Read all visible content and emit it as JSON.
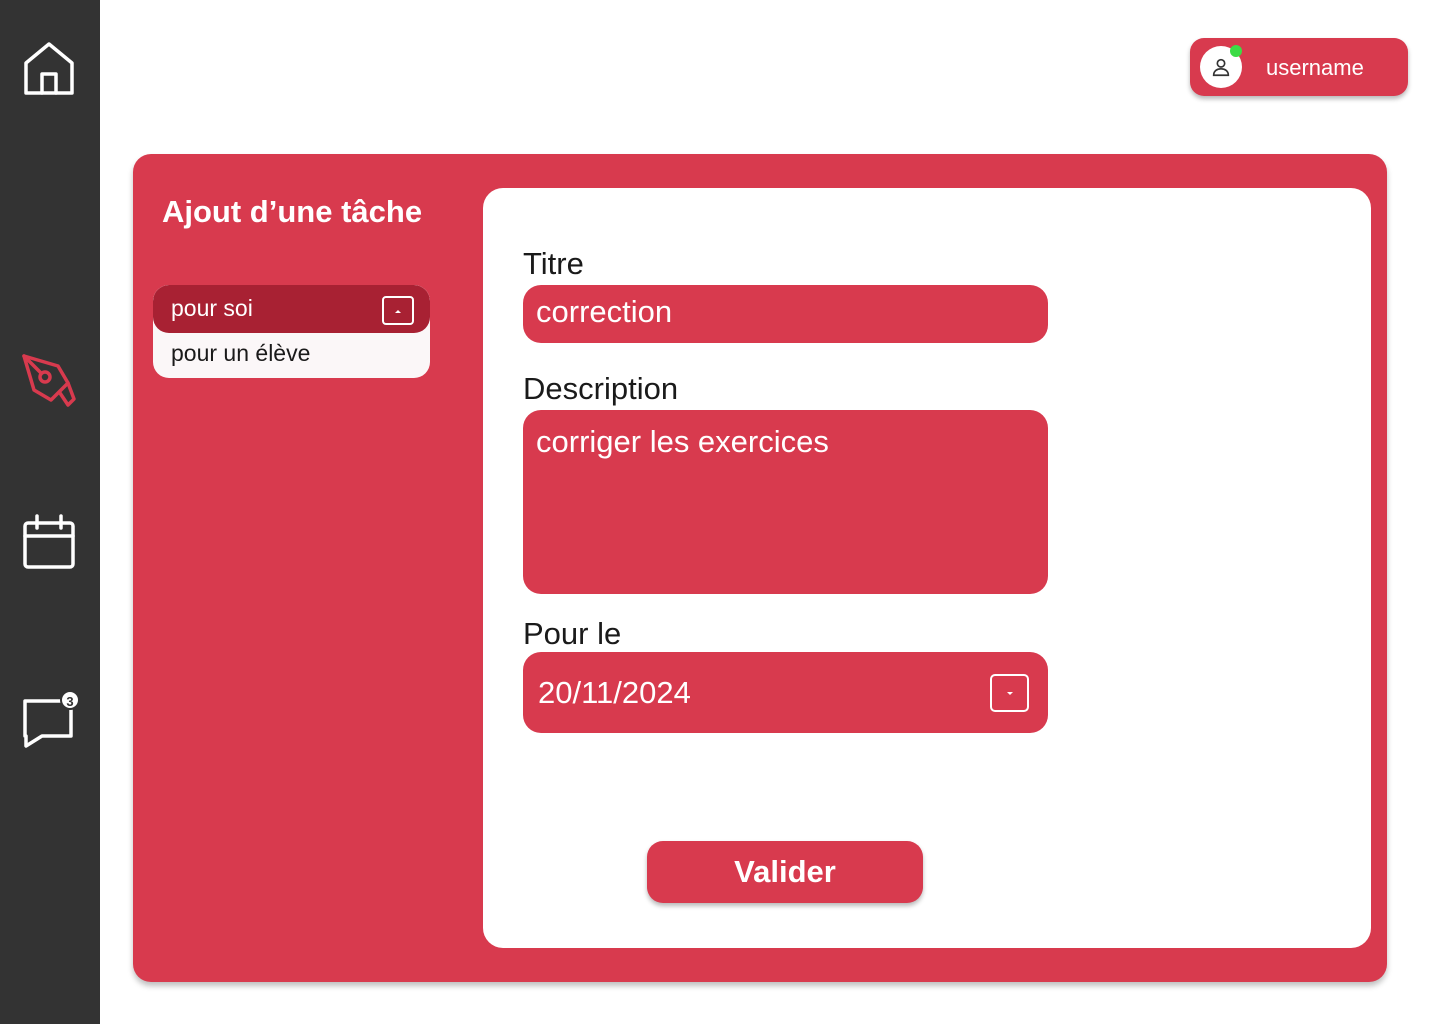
{
  "sidebar": {
    "items": [
      {
        "icon": "home-icon",
        "active": false
      },
      {
        "icon": "pen-nib-icon",
        "active": true
      },
      {
        "icon": "calendar-icon",
        "active": false
      },
      {
        "icon": "chat-bubble-icon",
        "active": false,
        "badge": "3"
      }
    ]
  },
  "user": {
    "name": "username",
    "status": "online",
    "icon": "user-icon"
  },
  "panel": {
    "title": "Ajout d’une tâche",
    "recipient_dropdown": {
      "selected": "pour soi",
      "options": [
        "pour soi",
        "pour un élève"
      ],
      "toggle_icon": "caret-up-icon"
    }
  },
  "form": {
    "title_label": "Titre",
    "title_value": "correction",
    "description_label": "Description",
    "description_value": "corriger les exercices",
    "date_label": "Pour le",
    "date_value": "20/11/2024",
    "date_toggle_icon": "caret-down-icon",
    "submit_label": "Valider"
  },
  "colors": {
    "sidebar": "#333333",
    "accent": "#d83a4e",
    "accent_dark": "#a82133",
    "online": "#3ddb45",
    "card": "#ffffff"
  }
}
